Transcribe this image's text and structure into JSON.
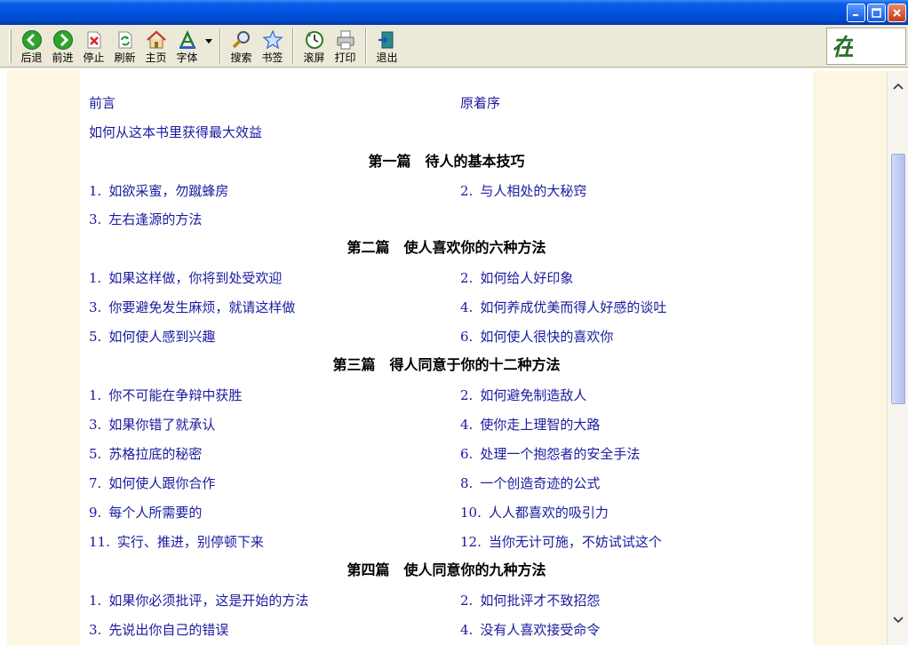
{
  "toolbar": {
    "back": "后退",
    "forward": "前进",
    "stop": "停止",
    "refresh": "刷新",
    "home": "主页",
    "font": "字体",
    "search": "搜索",
    "bookmark": "书签",
    "scroll": "滚屏",
    "print": "打印",
    "exit": "退出"
  },
  "logo_text": "在",
  "toc": {
    "intro": {
      "left": "前言",
      "right": "原着序"
    },
    "intro2": "如何从这本书里获得最大效益",
    "part1": {
      "title": "第一篇　待人的基本技巧",
      "items": [
        {
          "num": "1.",
          "text": "如欲采蜜，勿蹴蜂房"
        },
        {
          "num": "2.",
          "text": "与人相处的大秘窍"
        },
        {
          "num": "3.",
          "text": "左右逢源的方法"
        }
      ]
    },
    "part2": {
      "title": "第二篇　使人喜欢你的六种方法",
      "items": [
        {
          "num": "1.",
          "text": "如果这样做，你将到处受欢迎"
        },
        {
          "num": "2.",
          "text": "如何给人好印象"
        },
        {
          "num": "3.",
          "text": "你要避免发生麻烦，就请这样做"
        },
        {
          "num": "4.",
          "text": "如何养成优美而得人好感的谈吐"
        },
        {
          "num": "5.",
          "text": "如何使人感到兴趣"
        },
        {
          "num": "6.",
          "text": "如何使人很快的喜欢你"
        }
      ]
    },
    "part3": {
      "title": "第三篇　得人同意于你的十二种方法",
      "items": [
        {
          "num": "1.",
          "text": "你不可能在争辩中获胜"
        },
        {
          "num": "2.",
          "text": "如何避免制造敌人"
        },
        {
          "num": "3.",
          "text": "如果你错了就承认"
        },
        {
          "num": "4.",
          "text": "使你走上理智的大路"
        },
        {
          "num": "5.",
          "text": "苏格拉底的秘密"
        },
        {
          "num": "6.",
          "text": "处理一个抱怨者的安全手法"
        },
        {
          "num": "7.",
          "text": "如何使人跟你合作"
        },
        {
          "num": "8.",
          "text": "一个创造奇迹的公式"
        },
        {
          "num": "9.",
          "text": "每个人所需要的"
        },
        {
          "num": "10.",
          "text": "人人都喜欢的吸引力"
        },
        {
          "num": "11.",
          "text": "实行、推进，别停顿下来"
        },
        {
          "num": "12.",
          "text": "当你无计可施，不妨试试这个"
        }
      ]
    },
    "part4": {
      "title": "第四篇　使人同意你的九种方法",
      "items": [
        {
          "num": "1.",
          "text": "如果你必须批评，这是开始的方法"
        },
        {
          "num": "2.",
          "text": "如何批评才不致招怨"
        },
        {
          "num": "3.",
          "text": "先说出你自己的错误"
        },
        {
          "num": "4.",
          "text": "没有人喜欢接受命令"
        }
      ]
    }
  }
}
